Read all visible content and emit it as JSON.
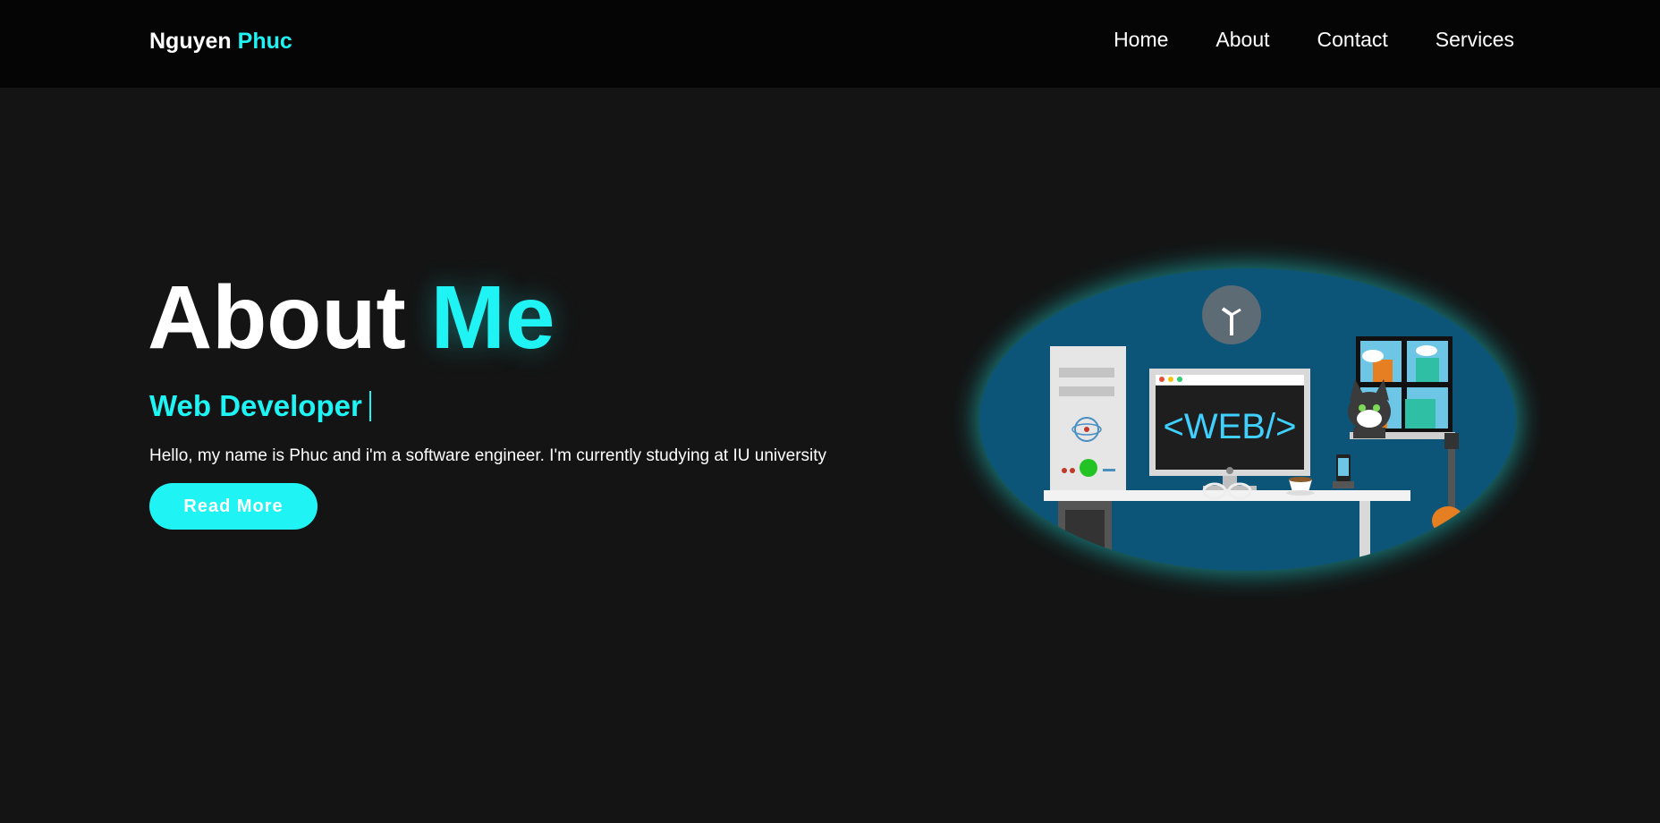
{
  "header": {
    "logo": {
      "first": "Nguyen",
      "second": "Phuc"
    },
    "nav": [
      "Home",
      "About",
      "Contact",
      "Services"
    ]
  },
  "hero": {
    "title": {
      "first": "About",
      "second": "Me"
    },
    "subtitle": "Web Developer",
    "intro": "Hello, my name is Phuc and i'm a software engineer. I'm currently studying at IU university",
    "button": "Read More",
    "image": {
      "screen_text": "<WEB/>"
    }
  },
  "colors": {
    "background": "#141414",
    "header_bg": "#050505",
    "accent": "#1ff3f3",
    "image_bg": "#0c5478"
  }
}
